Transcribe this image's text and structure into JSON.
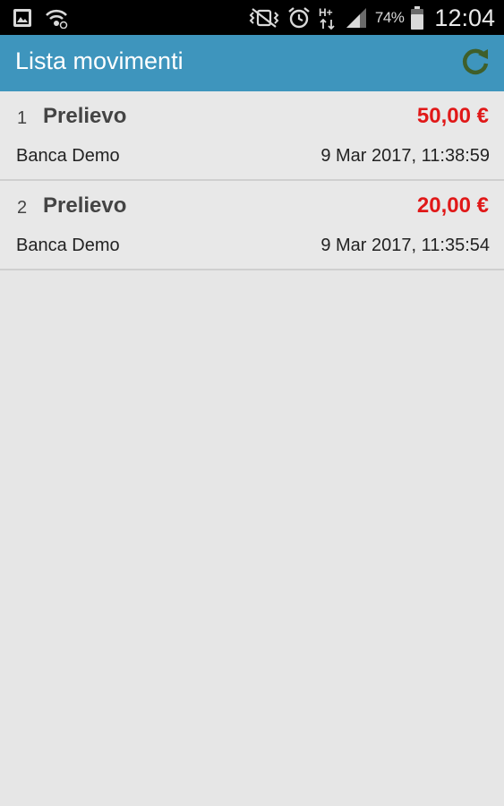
{
  "status_bar": {
    "battery_percent": "74%",
    "time": "12:04",
    "icons": [
      "gallery-icon",
      "wifi-icon",
      "vibrate-icon",
      "alarm-icon",
      "hplus-data-icon",
      "signal-icon",
      "battery-icon"
    ]
  },
  "app_bar": {
    "title": "Lista movimenti",
    "refresh_icon": "refresh-icon",
    "refresh_color": "#3f5f2a",
    "background": "#3e95bd"
  },
  "transactions": [
    {
      "index": "1",
      "type": "Prelievo",
      "amount": "50,00 €",
      "bank": "Banca Demo",
      "date": "9 Mar 2017, 11:38:59"
    },
    {
      "index": "2",
      "type": "Prelievo",
      "amount": "20,00 €",
      "bank": "Banca Demo",
      "date": "9 Mar 2017, 11:35:54"
    }
  ],
  "colors": {
    "amount": "#e01818",
    "list_background": "#e6e6e6"
  }
}
